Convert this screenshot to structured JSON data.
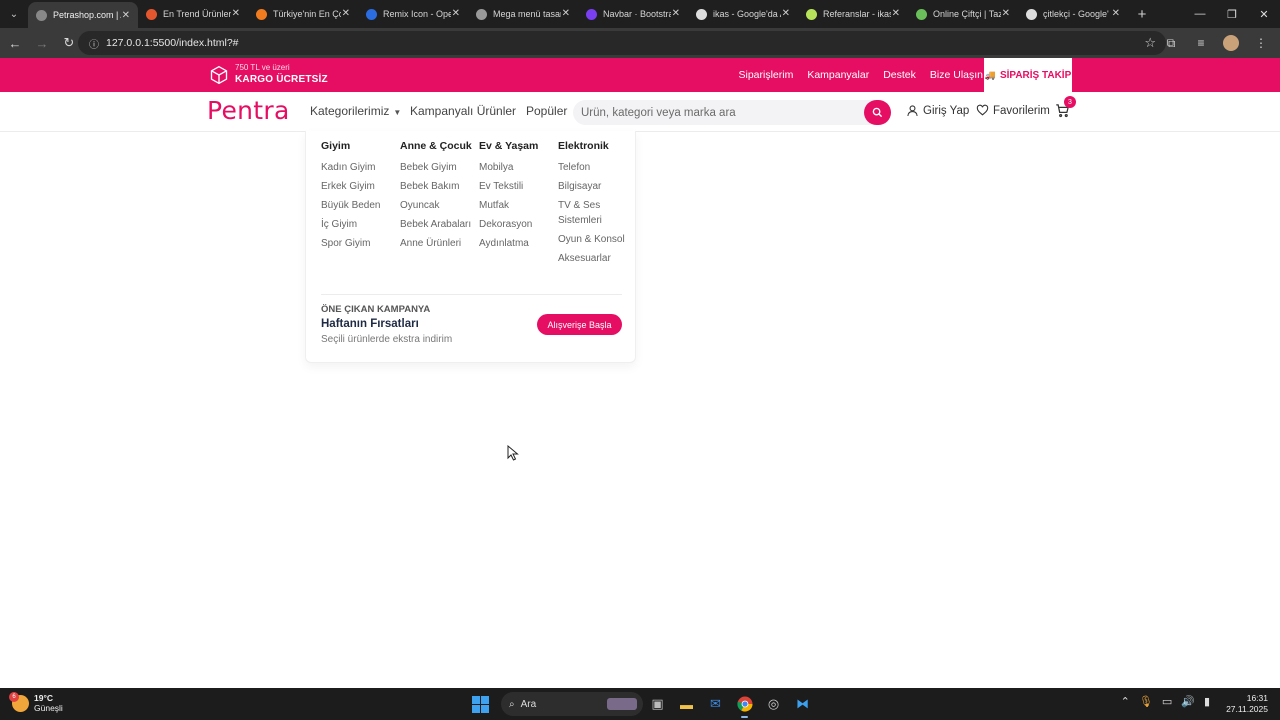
{
  "browser": {
    "tabs": [
      {
        "title": "Petrashop.com | A",
        "color": "#888888",
        "active": true
      },
      {
        "title": "En Trend Ürünler",
        "color": "#e4572e"
      },
      {
        "title": "Türkiye'nin En Ço",
        "color": "#f07c1f"
      },
      {
        "title": "Remix Icon - Ope",
        "color": "#2b6de0"
      },
      {
        "title": "Mega menü tasar",
        "color": "#999999"
      },
      {
        "title": "Navbar · Bootstra",
        "color": "#7a3ff0"
      },
      {
        "title": "ikas - Google'da A",
        "color": "#dddddd"
      },
      {
        "title": "Referanslar - ikas",
        "color": "#b7e35a"
      },
      {
        "title": "Online Çiftçi | Taz",
        "color": "#6abf5a"
      },
      {
        "title": "çitlekçi - Google'",
        "color": "#dddddd"
      }
    ],
    "url": "127.0.0.1:5500/index.html?#"
  },
  "topbar": {
    "shipping_line1": "750 TL ve üzeri",
    "shipping_line2": "KARGO ÜCRETSİZ",
    "links": [
      "Siparişlerim",
      "Kampanyalar",
      "Destek",
      "Bize Ulaşın"
    ],
    "track_label": "SİPARİŞ TAKİP",
    "brand_color": "#e60e63"
  },
  "nav": {
    "logo": "Pentra",
    "categories": "Kategorilerimiz",
    "campaign_products": "Kampanyalı Ürünler",
    "popular": "Popüler",
    "search_placeholder": "Ürün, kategori veya marka ara",
    "login": "Giriş Yap",
    "favorites": "Favorilerim",
    "cart_count": "3"
  },
  "mega_menu": {
    "columns": [
      {
        "title": "Giyim",
        "items": [
          "Kadın Giyim",
          "Erkek Giyim",
          "Büyük Beden",
          "İç Giyim",
          "Spor Giyim"
        ]
      },
      {
        "title": "Anne & Çocuk",
        "items": [
          "Bebek Giyim",
          "Bebek Bakım",
          "Oyuncak",
          "Bebek Arabaları",
          "Anne Ürünleri"
        ]
      },
      {
        "title": "Ev & Yaşam",
        "items": [
          "Mobilya",
          "Ev Tekstili",
          "Mutfak",
          "Dekorasyon",
          "Aydınlatma"
        ]
      },
      {
        "title": "Elektronik",
        "items": [
          "Telefon",
          "Bilgisayar",
          "TV & Ses Sistemleri",
          "Oyun & Konsol",
          "Aksesuarlar"
        ]
      }
    ],
    "promo": {
      "label": "ÖNE ÇIKAN KAMPANYA",
      "title": "Haftanın Fırsatları",
      "subtitle": "Seçili ürünlerde ekstra indirim",
      "button": "Alışverişe Başla"
    }
  },
  "taskbar": {
    "temp": "19°C",
    "weather": "Güneşli",
    "weather_badge": "6",
    "search": "Ara",
    "time": "16:31",
    "date": "27.11.2025"
  }
}
